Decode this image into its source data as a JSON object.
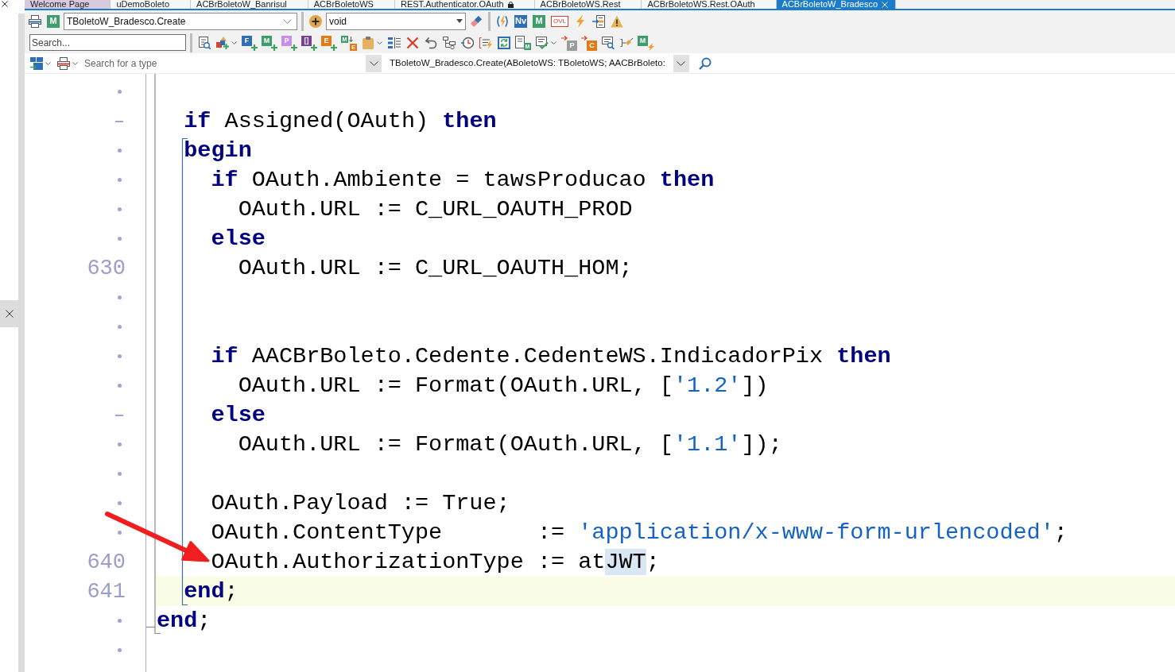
{
  "tabs": [
    {
      "label": "Welcome Page",
      "kind": "welcome",
      "selected": false,
      "locked": false
    },
    {
      "label": "uDemoBoleto",
      "kind": "file",
      "selected": false,
      "locked": false
    },
    {
      "label": "ACBrBoletoW_Banrisul",
      "kind": "file",
      "selected": false,
      "locked": false
    },
    {
      "label": "ACBrBoletoWS",
      "kind": "file",
      "selected": false,
      "locked": false
    },
    {
      "label": "REST.Authenticator.OAuth",
      "kind": "file",
      "selected": false,
      "locked": true
    },
    {
      "label": "ACBrBoletoWS.Rest",
      "kind": "file",
      "selected": false,
      "locked": false
    },
    {
      "label": "ACBrBoletoWS.Rest.OAuth",
      "kind": "file",
      "selected": false,
      "locked": false
    },
    {
      "label": "ACBrBoletoW_Bradesco",
      "kind": "file",
      "selected": true,
      "locked": false
    }
  ],
  "toolbar_1": {
    "method_tile": {
      "label": "M",
      "color": "#3f9c6b"
    },
    "method_combo": {
      "value": "TBoletoW_Bradesco.Create"
    },
    "type_combo": {
      "value": "void"
    },
    "tiles": [
      {
        "label": "Nv",
        "kind": "solid",
        "color": "#2f6db5"
      },
      {
        "label": "M",
        "kind": "solid",
        "color": "#3f9c6b"
      },
      {
        "label": "OVL",
        "kind": "outline",
        "color": "#d9412b"
      }
    ]
  },
  "toolbar_2": {
    "search": {
      "placeholder": "Search..."
    },
    "tiles": [
      {
        "label": "F",
        "kind": "add",
        "color": "#2f6db5"
      },
      {
        "label": "M",
        "kind": "add",
        "color": "#3f9c6b"
      },
      {
        "label": "P",
        "kind": "add",
        "color": "#c98fe6"
      },
      {
        "label": "[]",
        "kind": "add",
        "color": "#7b3f9a"
      },
      {
        "label": "E",
        "kind": "add",
        "color": "#e07b16"
      },
      {
        "label": "M",
        "kind": "convert",
        "color": "#3f9c6b",
        "target": {
          "label": "E",
          "color": "#e07b16"
        }
      },
      {
        "label": "M",
        "kind": "doc",
        "color": "#3f9c6b"
      },
      {
        "label": "P",
        "kind": "arrow",
        "color": "#9b9b9b"
      },
      {
        "label": "C",
        "kind": "arrow",
        "color": "#e07b16"
      },
      {
        "label": "M",
        "kind": "bolt",
        "color": "#3f9c6b"
      }
    ]
  },
  "toolbar_3": {
    "type_search": {
      "placeholder": "Search for a type"
    },
    "member_combo": {
      "value": "TBoletoW_Bradesco.Create(ABoletoWS: TBoletoWS; AACBrBoleto:"
    }
  },
  "editor": {
    "rows": [
      {
        "kind": "dot",
        "current": false
      },
      {
        "kind": "dash",
        "current": false,
        "code": [
          {
            "kind": "keyword",
            "text": "  if"
          },
          {
            "kind": "plain",
            "text": " Assigned(OAuth) "
          },
          {
            "kind": "keyword",
            "text": "then"
          }
        ]
      },
      {
        "kind": "dot",
        "current": false,
        "code": [
          {
            "kind": "keyword",
            "text": "  begin"
          }
        ]
      },
      {
        "kind": "dot",
        "current": false,
        "code": [
          {
            "kind": "keyword",
            "text": "    if"
          },
          {
            "kind": "plain",
            "text": " OAuth.Ambiente = tawsProducao "
          },
          {
            "kind": "keyword",
            "text": "then"
          }
        ]
      },
      {
        "kind": "dot",
        "current": false,
        "code": [
          {
            "kind": "plain",
            "text": "      OAuth.URL := C_URL_OAUTH_PROD"
          }
        ]
      },
      {
        "kind": "dot",
        "current": false,
        "code": [
          {
            "kind": "keyword",
            "text": "    else"
          }
        ]
      },
      {
        "kind": "numbered",
        "number": "630",
        "current": false,
        "code": [
          {
            "kind": "plain",
            "text": "      OAuth.URL := C_URL_OAUTH_HOM;"
          }
        ]
      },
      {
        "kind": "dot",
        "current": false
      },
      {
        "kind": "dot",
        "current": false
      },
      {
        "kind": "dot",
        "current": false,
        "code": [
          {
            "kind": "keyword",
            "text": "    if"
          },
          {
            "kind": "plain",
            "text": " AACBrBoleto.Cedente.CedenteWS.IndicadorPix "
          },
          {
            "kind": "keyword",
            "text": "then"
          }
        ]
      },
      {
        "kind": "dot",
        "current": false,
        "code": [
          {
            "kind": "plain",
            "text": "      OAuth.URL := Format(OAuth.URL, ["
          },
          {
            "kind": "string",
            "text": "'1.2'"
          },
          {
            "kind": "plain",
            "text": "])"
          }
        ]
      },
      {
        "kind": "dash",
        "current": false,
        "code": [
          {
            "kind": "keyword",
            "text": "    else"
          }
        ]
      },
      {
        "kind": "dot",
        "current": false,
        "code": [
          {
            "kind": "plain",
            "text": "      OAuth.URL := Format(OAuth.URL, ["
          },
          {
            "kind": "string",
            "text": "'1.1'"
          },
          {
            "kind": "plain",
            "text": "]);"
          }
        ]
      },
      {
        "kind": "dot",
        "current": false
      },
      {
        "kind": "dot",
        "current": false,
        "code": [
          {
            "kind": "plain",
            "text": "    OAuth.Payload := True;"
          }
        ]
      },
      {
        "kind": "dot",
        "current": false,
        "code": [
          {
            "kind": "plain",
            "text": "    OAuth.ContentType       := "
          },
          {
            "kind": "string",
            "text": "'application/x-www-form-urlencoded'"
          },
          {
            "kind": "plain",
            "text": ";"
          }
        ]
      },
      {
        "kind": "numbered",
        "number": "640",
        "current": false,
        "code": [
          {
            "kind": "plain",
            "text": "    OAuth.AuthorizationType := at"
          },
          {
            "kind": "match",
            "text": "JWT"
          },
          {
            "kind": "plain",
            "text": ";"
          }
        ]
      },
      {
        "kind": "numbered",
        "number": "641",
        "current": true,
        "code": [
          {
            "kind": "keyword",
            "text": "  end"
          },
          {
            "kind": "plain",
            "text": ";"
          }
        ]
      },
      {
        "kind": "dot",
        "current": false,
        "code": [
          {
            "kind": "keyword",
            "text": "end"
          },
          {
            "kind": "plain",
            "text": ";"
          }
        ]
      },
      {
        "kind": "dot",
        "current": false
      }
    ]
  }
}
